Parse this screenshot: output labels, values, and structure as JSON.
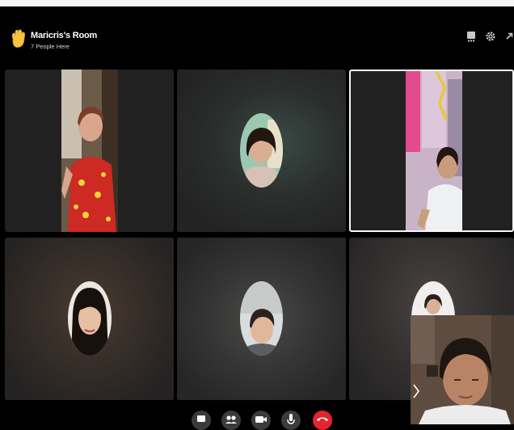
{
  "room": {
    "title": "Maricris's Room",
    "subtitle": "7 People Here"
  },
  "header_icons": [
    "layout-icon",
    "settings-icon",
    "expand-icon"
  ],
  "participants": [
    {
      "tile": "top-left",
      "type": "video",
      "active": false
    },
    {
      "tile": "top-middle",
      "type": "avatar",
      "active": false
    },
    {
      "tile": "top-right",
      "type": "video",
      "active": true
    },
    {
      "tile": "bottom-left",
      "type": "avatar",
      "active": false
    },
    {
      "tile": "bottom-middle",
      "type": "avatar",
      "active": false
    },
    {
      "tile": "bottom-right",
      "type": "avatar",
      "active": false
    }
  ],
  "controls": [
    "share-screen-icon",
    "people-icon",
    "camera-icon",
    "microphone-icon",
    "end-call-icon"
  ],
  "colors": {
    "background": "#000000",
    "tile": "#212121",
    "control": "#3a3b3c",
    "end_call": "#e4252e",
    "active_border": "#f5f5f5"
  }
}
